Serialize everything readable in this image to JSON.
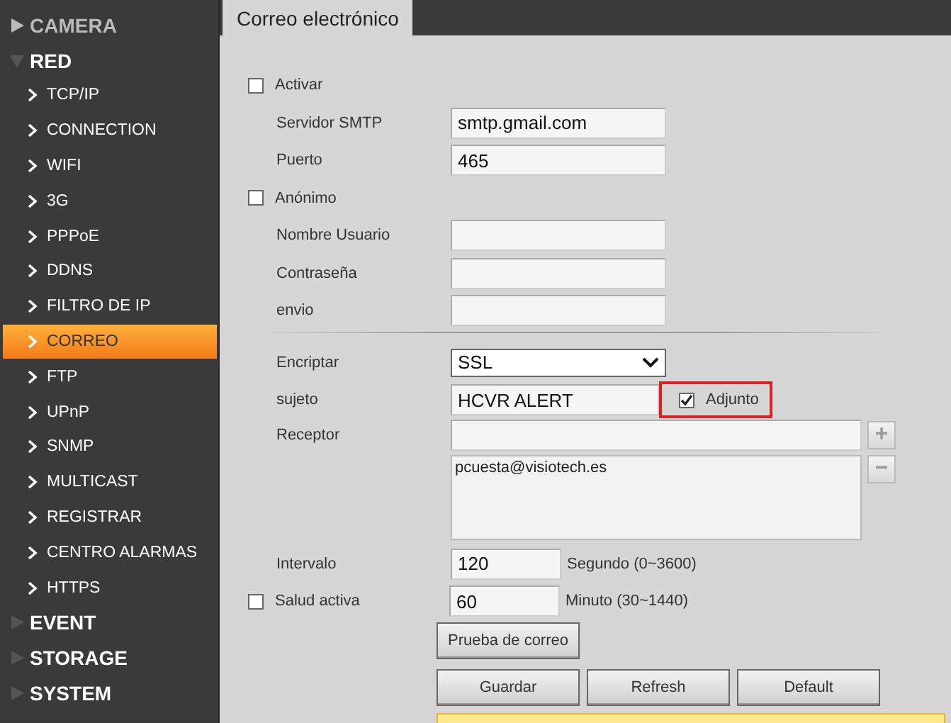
{
  "sidebar": {
    "items": [
      {
        "label": "CAMERA",
        "expanded": false
      },
      {
        "label": "RED",
        "expanded": true,
        "children": [
          {
            "label": "TCP/IP",
            "selected": false
          },
          {
            "label": "CONNECTION",
            "selected": false
          },
          {
            "label": "WIFI",
            "selected": false
          },
          {
            "label": "3G",
            "selected": false
          },
          {
            "label": "PPPoE",
            "selected": false
          },
          {
            "label": "DDNS",
            "selected": false
          },
          {
            "label": "FILTRO DE IP",
            "selected": false
          },
          {
            "label": "CORREO",
            "selected": true
          },
          {
            "label": "FTP",
            "selected": false
          },
          {
            "label": "UPnP",
            "selected": false
          },
          {
            "label": "SNMP",
            "selected": false
          },
          {
            "label": "MULTICAST",
            "selected": false
          },
          {
            "label": "REGISTRAR",
            "selected": false
          },
          {
            "label": "CENTRO ALARMAS",
            "selected": false
          },
          {
            "label": "HTTPS",
            "selected": false
          }
        ]
      },
      {
        "label": "EVENT",
        "expanded": false
      },
      {
        "label": "STORAGE",
        "expanded": false
      },
      {
        "label": "SYSTEM",
        "expanded": false
      }
    ]
  },
  "tab": {
    "label": "Correo electrónico"
  },
  "form": {
    "enable": {
      "label": "Activar",
      "checked": false
    },
    "smtp_server": {
      "label": "Servidor SMTP",
      "value": "smtp.gmail.com"
    },
    "port": {
      "label": "Puerto",
      "value": "465"
    },
    "anonymous": {
      "label": "Anónimo",
      "checked": false
    },
    "username": {
      "label": "Nombre Usuario"
    },
    "password": {
      "label": "Contraseña"
    },
    "sender": {
      "label": "envio"
    },
    "encryption": {
      "label": "Encriptar",
      "value": "SSL"
    },
    "subject": {
      "label": "sujeto",
      "value": "HCVR ALERT"
    },
    "attachment": {
      "label": "Adjunto",
      "checked": true
    },
    "receiver": {
      "label": "Receptor",
      "add": "+",
      "remove": "−",
      "list": [
        "pcuesta@visiotech.es"
      ]
    },
    "interval": {
      "label": "Intervalo",
      "value": "120",
      "unit": "Segundo (0~3600)"
    },
    "health": {
      "label": "Salud activa",
      "checked": false,
      "value": "60",
      "unit": "Minuto (30~1440)"
    },
    "test_button": "Prueba de correo",
    "buttons": [
      "Guardar",
      "Refresh",
      "Default"
    ]
  }
}
